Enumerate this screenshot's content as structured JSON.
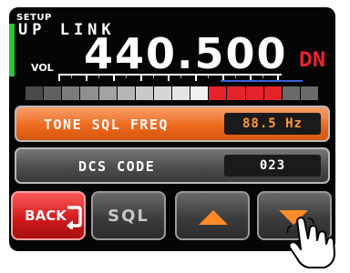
{
  "header": {
    "setup_label": "SETUP",
    "mode_label": "UP LINK",
    "vol_label": "VOL",
    "frequency": "440.500",
    "direction": "DN"
  },
  "meter": {
    "segment_colors": [
      "#4a4a4a",
      "#606060",
      "#7c7c7c",
      "#8f8f8f",
      "#a3a3a3",
      "#b5b5b5",
      "#c8c8c8",
      "#d6d6d6",
      "#e4e4e4",
      "#f0f0f0",
      "#e5232a",
      "#e5232a",
      "#e5232a",
      "#e5232a",
      "#6a6a6a",
      "#6a6a6a"
    ]
  },
  "rows": {
    "tone": {
      "label": "TONE SQL FREQ",
      "value": "88.5 Hz"
    },
    "dcs": {
      "label": "DCS CODE",
      "value": "023"
    }
  },
  "buttons": {
    "back": {
      "label": "BACK",
      "icon": "return-arrow-icon"
    },
    "sql": {
      "label": "SQL"
    },
    "up": {
      "icon": "up-triangle-icon"
    },
    "down": {
      "icon": "down-triangle-icon"
    }
  },
  "colors": {
    "accent_orange": "#ee6a1f",
    "back_red": "#d11b1b",
    "signal_green": "#2ec23b",
    "direction_red": "#e8232a"
  }
}
